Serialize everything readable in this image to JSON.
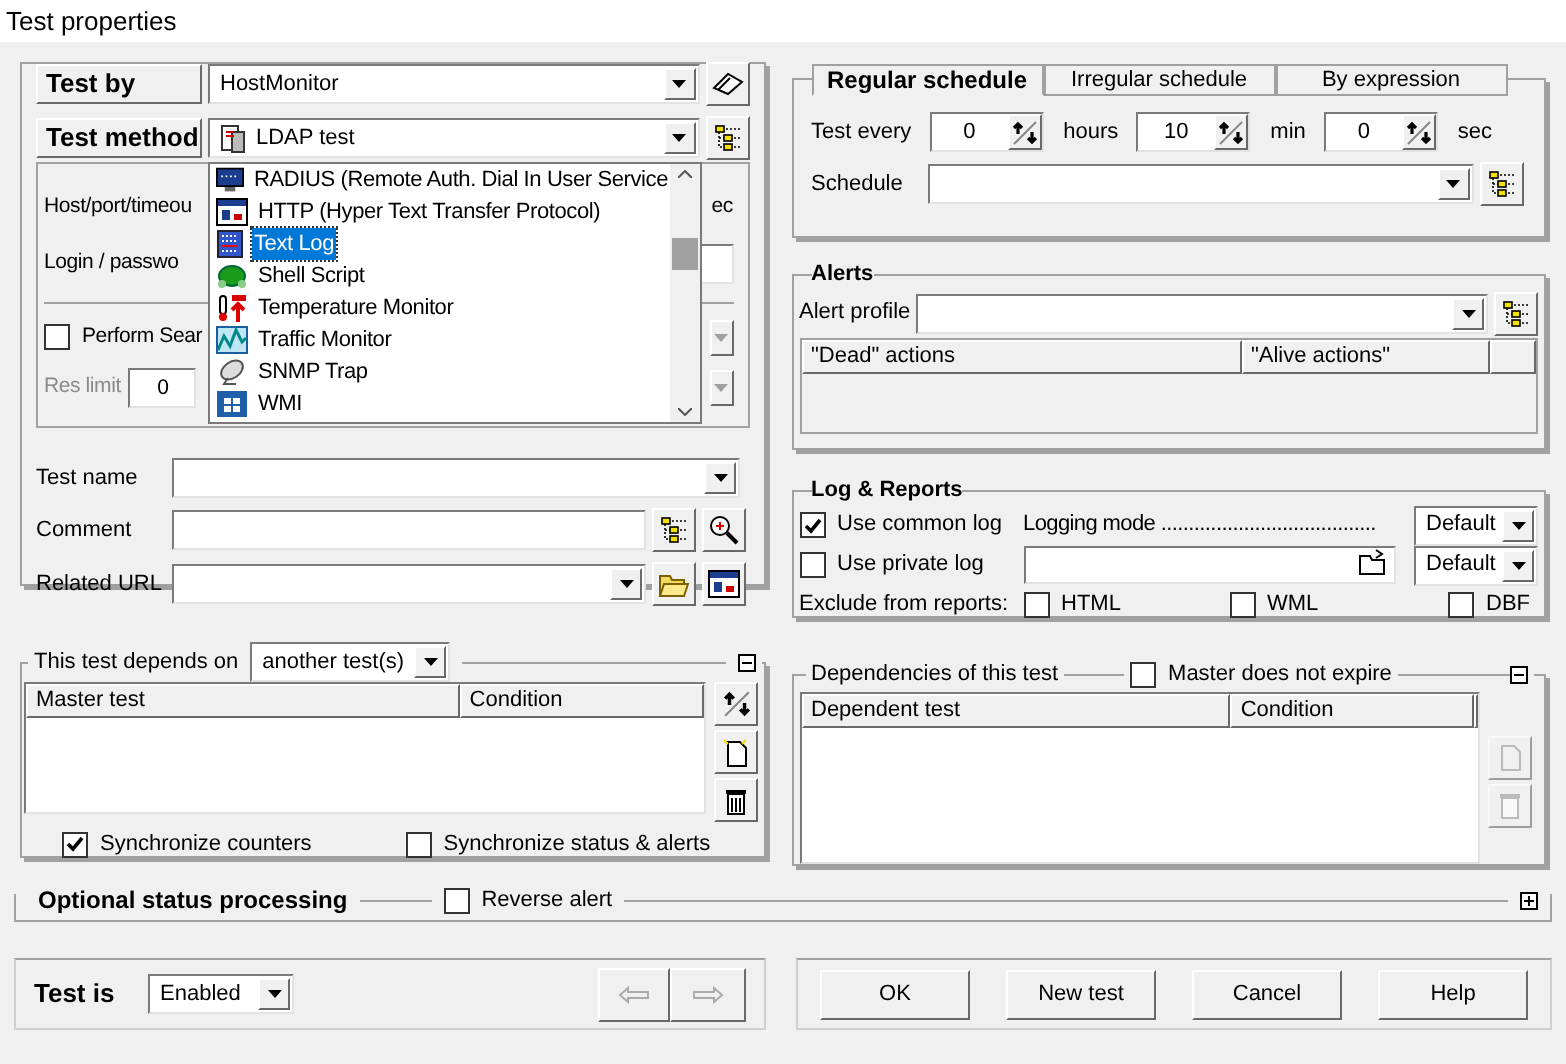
{
  "window": {
    "title": "Test properties"
  },
  "test_by": {
    "label": "Test by",
    "value": "HostMonitor"
  },
  "test_method": {
    "label": "Test method",
    "value": "LDAP test",
    "options": [
      {
        "label": "RADIUS (Remote Auth. Dial In User Service",
        "kind": "monitor",
        "selected": false
      },
      {
        "label": "HTTP (Hyper Text Transfer Protocol)",
        "kind": "window",
        "selected": false
      },
      {
        "label": "Text Log",
        "kind": "grid",
        "selected": true
      },
      {
        "label": "Shell Script",
        "kind": "shell",
        "selected": false
      },
      {
        "label": "Temperature Monitor",
        "kind": "thermo",
        "selected": false
      },
      {
        "label": "Traffic Monitor",
        "kind": "traffic",
        "selected": false
      },
      {
        "label": "SNMP Trap",
        "kind": "dish",
        "selected": false
      },
      {
        "label": "WMI",
        "kind": "win",
        "selected": false
      }
    ]
  },
  "method_fields": {
    "host_label": "Host/port/timeou",
    "sec_label": "ec",
    "login_label": "Login / passwo",
    "perform_search": {
      "label": "Perform Sear",
      "checked": false
    },
    "res_limit": {
      "label": "Res limit",
      "value": "0"
    }
  },
  "general": {
    "test_name": "Test name",
    "comment": "Comment",
    "related_url": "Related URL"
  },
  "depends": {
    "label": "This test depends on",
    "mode": "another test(s)",
    "expanded": true,
    "columns": [
      "Master test",
      "Condition"
    ],
    "sync_counters": {
      "label": "Synchronize counters",
      "checked": true
    },
    "sync_status": {
      "label": "Synchronize status & alerts",
      "checked": false
    }
  },
  "optional": {
    "label": "Optional status processing",
    "expanded": false,
    "reverse_alert": {
      "label": "Reverse alert",
      "checked": false
    }
  },
  "test_is": {
    "label": "Test is",
    "value": "Enabled"
  },
  "schedule": {
    "tabs": [
      {
        "label": "Regular schedule",
        "selected": true
      },
      {
        "label": "Irregular schedule",
        "selected": false
      },
      {
        "label": "By expression",
        "selected": false
      }
    ],
    "test_every": "Test every",
    "hours": {
      "value": "0",
      "unit": "hours"
    },
    "minutes": {
      "value": "10",
      "unit": "min"
    },
    "seconds": {
      "value": "0",
      "unit": "sec"
    },
    "schedule_label": "Schedule"
  },
  "alerts": {
    "title": "Alerts",
    "profile_label": "Alert profile",
    "columns": [
      "\"Dead\" actions",
      "\"Alive actions\""
    ]
  },
  "log": {
    "title": "Log & Reports",
    "common": {
      "label": "Use common log",
      "checked": true
    },
    "logging_mode": "Logging mode .......................................",
    "mode_common": "Default",
    "private": {
      "label": "Use private log",
      "checked": false
    },
    "mode_private": "Default",
    "exclude_label": "Exclude from reports:",
    "exclude": [
      {
        "label": "HTML",
        "checked": false
      },
      {
        "label": "WML",
        "checked": false
      },
      {
        "label": "DBF",
        "checked": false
      }
    ]
  },
  "dependencies": {
    "title": "Dependencies of this test",
    "expanded": true,
    "master": {
      "label": "Master does not expire",
      "checked": false
    },
    "columns": [
      "Dependent test",
      "Condition"
    ]
  },
  "buttons": [
    {
      "label": "OK"
    },
    {
      "label": "New test"
    },
    {
      "label": "Cancel"
    },
    {
      "label": "Help"
    }
  ]
}
